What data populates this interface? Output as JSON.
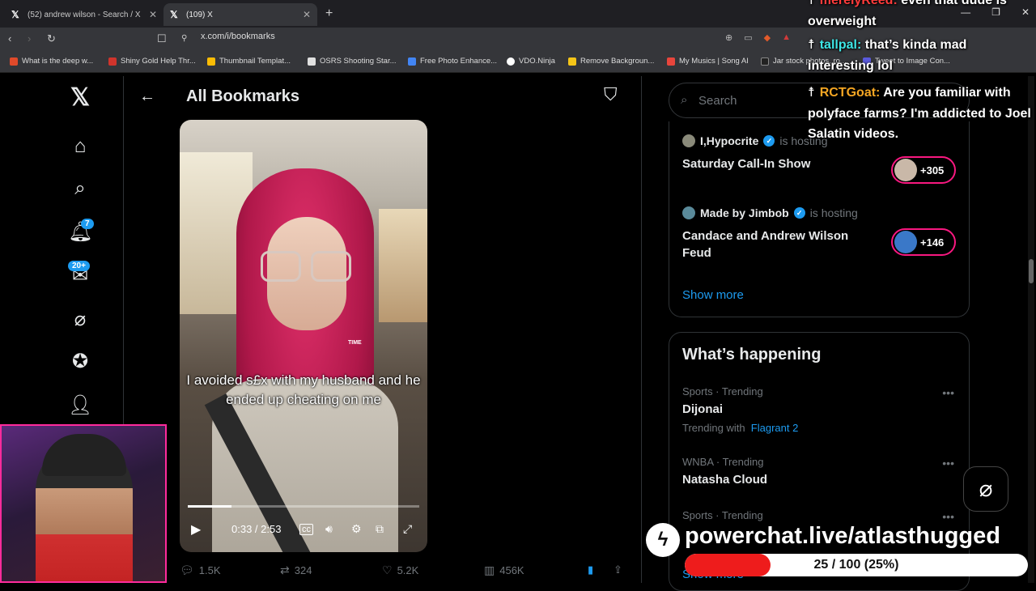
{
  "browser": {
    "tabs": [
      {
        "label": "(52) andrew wilson - Search / X"
      },
      {
        "label": "(109) X"
      }
    ],
    "url": "x.com/i/bookmarks",
    "bookmarks": [
      {
        "label": "What is the deep w...",
        "color": "#e04a2a"
      },
      {
        "label": "Shiny Gold Help Thr...",
        "color": "#d0342c"
      },
      {
        "label": "Thumbnail Templat...",
        "color": "#fbbc05"
      },
      {
        "label": "OSRS Shooting Star...",
        "color": "#e0e0e0"
      },
      {
        "label": "Free Photo Enhance...",
        "color": "#4285f4"
      },
      {
        "label": "VDO.Ninja",
        "color": "#ffffff"
      },
      {
        "label": "Remove Backgroun...",
        "color": "#f5c518"
      },
      {
        "label": "My Musics | Song AI",
        "color": "#e8453c"
      },
      {
        "label": "Jar stock photos, ro...",
        "color": "#222222"
      },
      {
        "label": "Tweet to Image Con...",
        "color": "#5a5adc"
      }
    ]
  },
  "nav": {
    "notifications_badge": "7",
    "messages_badge": "20+"
  },
  "main": {
    "title": "All Bookmarks",
    "video": {
      "caption": "I avoided s£x with my husband and he ended up cheating on me",
      "overlay_label": "TIME",
      "time": "0:33 / 2:53",
      "progress": 0.19
    },
    "actions": {
      "replies": "1.5K",
      "reposts": "324",
      "likes": "5.2K",
      "views": "456K"
    }
  },
  "right": {
    "search_placeholder": "Search",
    "spaces": [
      {
        "host": "I,Hypocrite",
        "hosting": "is hosting",
        "title": "Saturday Call-In Show",
        "listeners": "+305"
      },
      {
        "host": "Made by Jimbob",
        "hosting": "is hosting",
        "title": "Candace and Andrew Wilson Feud",
        "listeners": "+146"
      }
    ],
    "show_more": "Show more",
    "happening_title": "What’s happening",
    "trends": [
      {
        "meta": "Sports · Trending",
        "name": "Dijonai",
        "with_label": "Trending with",
        "with_link": "Flagrant 2"
      },
      {
        "meta": "WNBA · Trending",
        "name": "Natasha Cloud"
      },
      {
        "meta": "Sports · Trending",
        "name": ""
      }
    ]
  },
  "overlay": {
    "chat": [
      {
        "user": "merelyReed:",
        "text": "even that dude is overweight",
        "color": "#ff3b3b"
      },
      {
        "user": "tallpal:",
        "text": "that’s kinda mad interesting lol",
        "color": "#3ee6e6"
      },
      {
        "user": "RCTGoat:",
        "text": "Are you familiar with polyface farms? I'm addicted to Joel Salatin videos.",
        "color": "#f5a623"
      }
    ],
    "powerchat_url": "powerchat.live/atlasthugged",
    "goal_text": "25 / 100 (25%)",
    "goal_progress": 0.25,
    "accent": "#ff2b9c"
  }
}
